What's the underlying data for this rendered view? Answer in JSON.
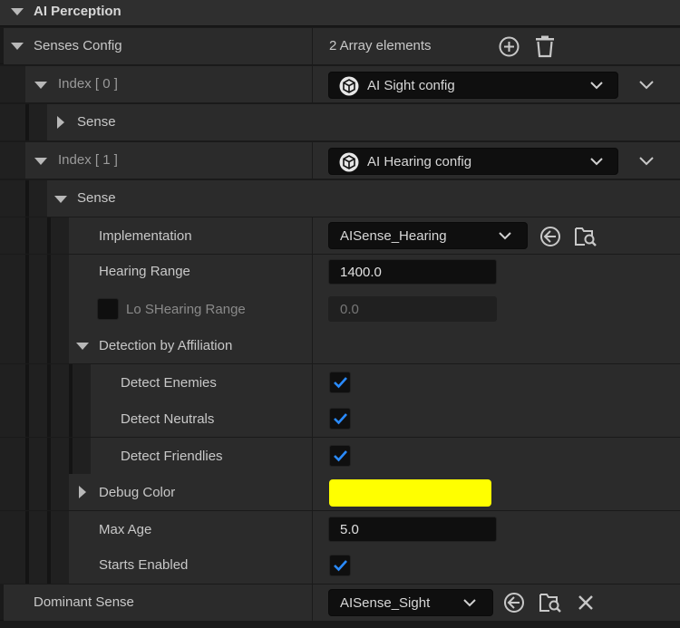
{
  "header": {
    "title": "AI Perception"
  },
  "senses_config": {
    "label": "Senses Config",
    "value": "2 Array elements"
  },
  "index0": {
    "label": "Index [ 0 ]",
    "selection": "AI Sight config",
    "sense_label": "Sense"
  },
  "index1": {
    "label": "Index [ 1 ]",
    "selection": "AI Hearing config",
    "sense_label": "Sense"
  },
  "implementation": {
    "label": "Implementation",
    "value": "AISense_Hearing"
  },
  "hearing_range": {
    "label": "Hearing Range",
    "value": "1400.0"
  },
  "lo_s_hearing_range": {
    "label": "Lo SHearing Range",
    "value": "0.0",
    "checked": false
  },
  "detection": {
    "label": "Detection by Affiliation",
    "enemies": {
      "label": "Detect Enemies",
      "checked": true
    },
    "neutrals": {
      "label": "Detect Neutrals",
      "checked": true
    },
    "friendlies": {
      "label": "Detect Friendlies",
      "checked": true
    }
  },
  "debug_color": {
    "label": "Debug Color",
    "color": "#ffff00"
  },
  "max_age": {
    "label": "Max Age",
    "value": "5.0"
  },
  "starts_enabled": {
    "label": "Starts Enabled",
    "checked": true
  },
  "dominant_sense": {
    "label": "Dominant Sense",
    "value": "AISense_Sight"
  },
  "colors": {
    "panel": "#2b2b2b",
    "field": "#0f0f0f",
    "checkmark": "#2a8bff",
    "text": "#c8c8c8"
  }
}
